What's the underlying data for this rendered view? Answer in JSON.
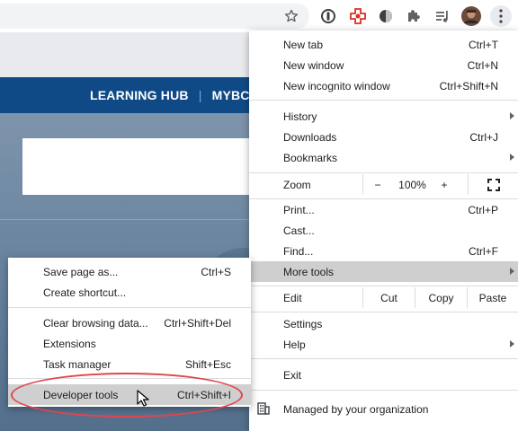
{
  "toolbar": {
    "icons": [
      "star-icon",
      "extension-circle-icon",
      "red-cross-extension-icon",
      "circle-extension-icon",
      "puzzle-icon",
      "media-queue-icon",
      "avatar",
      "three-dots-icon"
    ]
  },
  "site": {
    "nav_links": [
      "LEARNING HUB",
      "MYBCIT"
    ],
    "nav_color": "#0f4a86"
  },
  "menu": {
    "new_tab": {
      "label": "New tab",
      "shortcut": "Ctrl+T"
    },
    "new_window": {
      "label": "New window",
      "shortcut": "Ctrl+N"
    },
    "new_incognito": {
      "label": "New incognito window",
      "shortcut": "Ctrl+Shift+N"
    },
    "history": {
      "label": "History"
    },
    "downloads": {
      "label": "Downloads",
      "shortcut": "Ctrl+J"
    },
    "bookmarks": {
      "label": "Bookmarks"
    },
    "zoom": {
      "label": "Zoom",
      "minus": "−",
      "value": "100%",
      "plus": "+"
    },
    "print": {
      "label": "Print...",
      "shortcut": "Ctrl+P"
    },
    "cast": {
      "label": "Cast..."
    },
    "find": {
      "label": "Find...",
      "shortcut": "Ctrl+F"
    },
    "more_tools": {
      "label": "More tools"
    },
    "edit": {
      "label": "Edit",
      "cut": "Cut",
      "copy": "Copy",
      "paste": "Paste"
    },
    "settings": {
      "label": "Settings"
    },
    "help": {
      "label": "Help"
    },
    "exit": {
      "label": "Exit"
    },
    "managed": {
      "label": "Managed by your organization"
    }
  },
  "submenu": {
    "save_page": {
      "label": "Save page as...",
      "shortcut": "Ctrl+S"
    },
    "create_shortcut": {
      "label": "Create shortcut..."
    },
    "clear_data": {
      "label": "Clear browsing data...",
      "shortcut": "Ctrl+Shift+Del"
    },
    "extensions": {
      "label": "Extensions"
    },
    "task_manager": {
      "label": "Task manager",
      "shortcut": "Shift+Esc"
    },
    "developer_tools": {
      "label": "Developer tools",
      "shortcut": "Ctrl+Shift+I"
    }
  },
  "colors": {
    "highlight": "#cfcfcf",
    "annotation": "#e0454f"
  }
}
